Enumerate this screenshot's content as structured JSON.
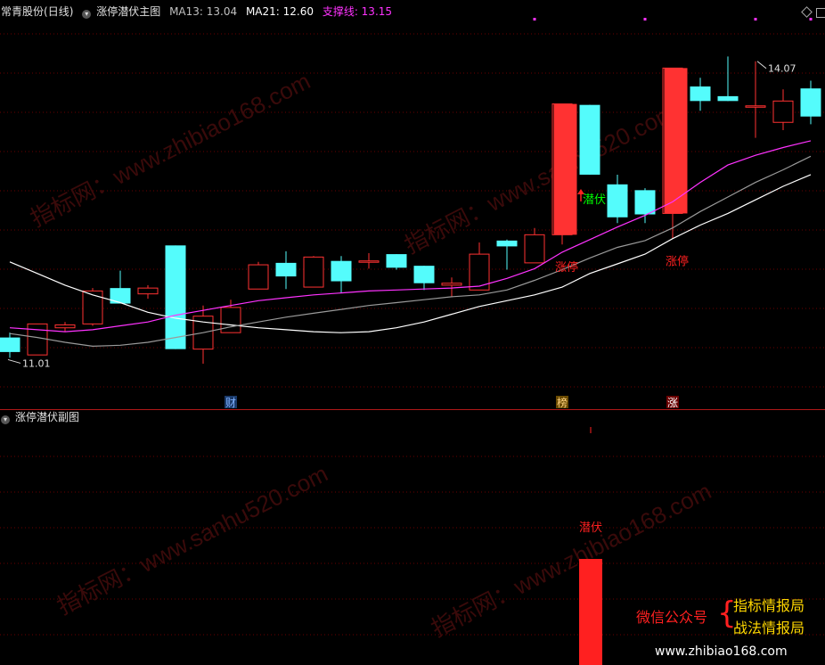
{
  "header_main": {
    "stock": "常青股份",
    "period": "(日线)",
    "indicator": "涨停潜伏主图",
    "ma13_label": "MA13: 13.04",
    "ma21_label": "MA21: 12.60",
    "support_label": "支撑线: 13.15"
  },
  "header_sub": {
    "indicator": "涨停潜伏副图"
  },
  "colors": {
    "up": "#ff3232",
    "down": "#54fcfc",
    "ma13": "#ff32ff",
    "ma21": "#9a9a9a",
    "support": "#ffffff",
    "grid": "#6a0000",
    "signal_red": "#ff2020",
    "signal_green": "#00ff00"
  },
  "chart_data": {
    "type": "candlestick",
    "ylim": [
      10.6,
      14.5
    ],
    "price_high_label": "14.07",
    "price_low_label": "11.01",
    "candles": [
      {
        "o": 11.22,
        "h": 11.27,
        "l": 11.01,
        "c": 11.07
      },
      {
        "o": 11.04,
        "h": 11.36,
        "l": 11.04,
        "c": 11.36
      },
      {
        "o": 11.32,
        "h": 11.38,
        "l": 11.28,
        "c": 11.35
      },
      {
        "o": 11.36,
        "h": 11.73,
        "l": 11.34,
        "c": 11.7
      },
      {
        "o": 11.73,
        "h": 11.91,
        "l": 11.57,
        "c": 11.57
      },
      {
        "o": 11.67,
        "h": 11.76,
        "l": 11.62,
        "c": 11.73
      },
      {
        "o": 12.17,
        "h": 12.17,
        "l": 11.1,
        "c": 11.1
      },
      {
        "o": 11.1,
        "h": 11.55,
        "l": 10.95,
        "c": 11.44
      },
      {
        "o": 11.27,
        "h": 11.61,
        "l": 11.27,
        "c": 11.53
      },
      {
        "o": 11.72,
        "h": 12.0,
        "l": 11.72,
        "c": 11.97
      },
      {
        "o": 11.99,
        "h": 12.11,
        "l": 11.72,
        "c": 11.85
      },
      {
        "o": 11.74,
        "h": 12.06,
        "l": 11.74,
        "c": 12.05
      },
      {
        "o": 12.01,
        "h": 12.06,
        "l": 11.68,
        "c": 11.8
      },
      {
        "o": 12.01,
        "h": 12.09,
        "l": 11.93,
        "c": 12.01
      },
      {
        "o": 12.08,
        "h": 12.08,
        "l": 11.92,
        "c": 11.94
      },
      {
        "o": 11.96,
        "h": 11.96,
        "l": 11.71,
        "c": 11.78
      },
      {
        "o": 11.76,
        "h": 11.84,
        "l": 11.64,
        "c": 11.78
      },
      {
        "o": 11.71,
        "h": 12.2,
        "l": 11.71,
        "c": 12.08
      },
      {
        "o": 12.22,
        "h": 12.23,
        "l": 11.92,
        "c": 12.16
      },
      {
        "o": 11.99,
        "h": 12.35,
        "l": 11.99,
        "c": 12.28
      },
      {
        "o": 12.28,
        "h": 13.63,
        "l": 12.18,
        "c": 13.63
      },
      {
        "o": 13.62,
        "h": 13.62,
        "l": 12.9,
        "c": 12.9
      },
      {
        "o": 12.8,
        "h": 12.9,
        "l": 12.4,
        "c": 12.46
      },
      {
        "o": 12.74,
        "h": 12.76,
        "l": 12.4,
        "c": 12.49
      },
      {
        "o": 12.5,
        "h": 14.0,
        "l": 12.24,
        "c": 14.0
      },
      {
        "o": 13.81,
        "h": 13.9,
        "l": 13.56,
        "c": 13.66
      },
      {
        "o": 13.71,
        "h": 14.12,
        "l": 13.66,
        "c": 13.66
      },
      {
        "o": 13.6,
        "h": 14.07,
        "l": 13.28,
        "c": 13.61
      },
      {
        "o": 13.44,
        "h": 13.78,
        "l": 13.36,
        "c": 13.66
      },
      {
        "o": 13.79,
        "h": 13.87,
        "l": 13.42,
        "c": 13.5
      }
    ],
    "ma13": [
      11.32,
      11.3,
      11.28,
      11.3,
      11.34,
      11.38,
      11.45,
      11.5,
      11.55,
      11.6,
      11.63,
      11.66,
      11.68,
      11.7,
      11.71,
      11.72,
      11.73,
      11.75,
      11.83,
      11.93,
      12.1,
      12.23,
      12.36,
      12.48,
      12.62,
      12.82,
      13.0,
      13.1,
      13.18,
      13.25
    ],
    "ma21": [
      11.26,
      11.22,
      11.17,
      11.13,
      11.14,
      11.17,
      11.22,
      11.27,
      11.33,
      11.38,
      11.43,
      11.47,
      11.51,
      11.55,
      11.58,
      11.61,
      11.64,
      11.66,
      11.71,
      11.81,
      11.92,
      12.04,
      12.15,
      12.22,
      12.35,
      12.52,
      12.67,
      12.82,
      12.95,
      13.09
    ],
    "support": [
      12.0,
      11.88,
      11.76,
      11.66,
      11.58,
      11.48,
      11.42,
      11.38,
      11.35,
      11.32,
      11.3,
      11.28,
      11.27,
      11.28,
      11.32,
      11.38,
      11.46,
      11.54,
      11.6,
      11.66,
      11.74,
      11.88,
      11.98,
      12.08,
      12.24,
      12.38,
      12.5,
      12.64,
      12.78,
      12.9
    ],
    "purple_dots": [
      19,
      23,
      27,
      29
    ],
    "main_signals": [
      {
        "index": 20,
        "text": "涨停"
      },
      {
        "index": 21,
        "text": "潜伏"
      },
      {
        "index": 24,
        "text": "涨停"
      }
    ],
    "bottom_markers": [
      {
        "index": 8,
        "text": "财"
      },
      {
        "index": 20,
        "text": "榜"
      },
      {
        "index": 24,
        "text": "涨"
      }
    ],
    "sub": {
      "signal_index": 21,
      "signal_text": "潜伏",
      "bar_value": 1
    }
  },
  "ad": {
    "label": "微信公众号",
    "line1": "指标情报局",
    "line2": "战法情报局",
    "url": "www.zhibiao168.com"
  }
}
